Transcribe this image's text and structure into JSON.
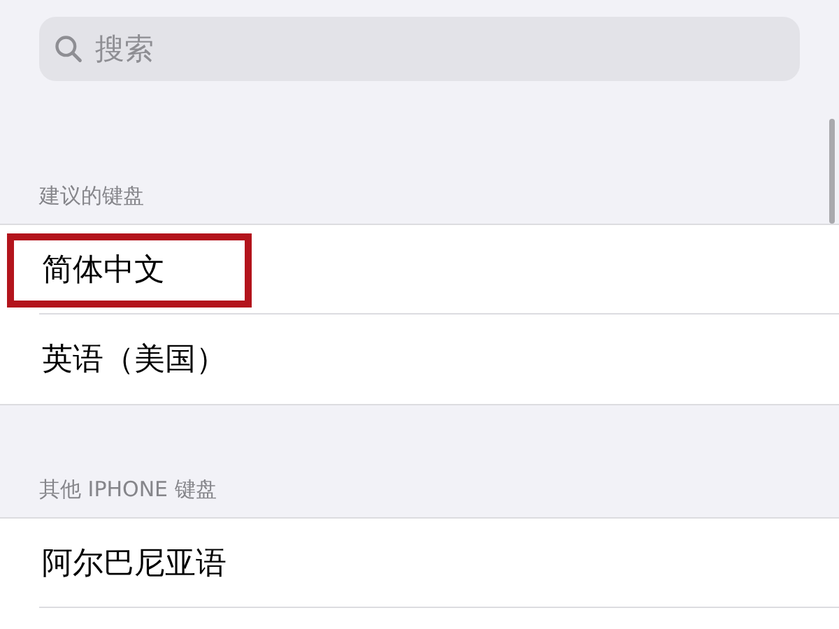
{
  "search": {
    "placeholder": "搜索"
  },
  "sections": [
    {
      "header": "建议的键盘",
      "items": [
        {
          "label": "简体中文",
          "highlighted": true
        },
        {
          "label": "英语（美国）",
          "highlighted": false
        }
      ]
    },
    {
      "header": "其他 IPHONE 键盘",
      "items": [
        {
          "label": "阿尔巴尼亚语",
          "highlighted": false
        }
      ]
    }
  ]
}
